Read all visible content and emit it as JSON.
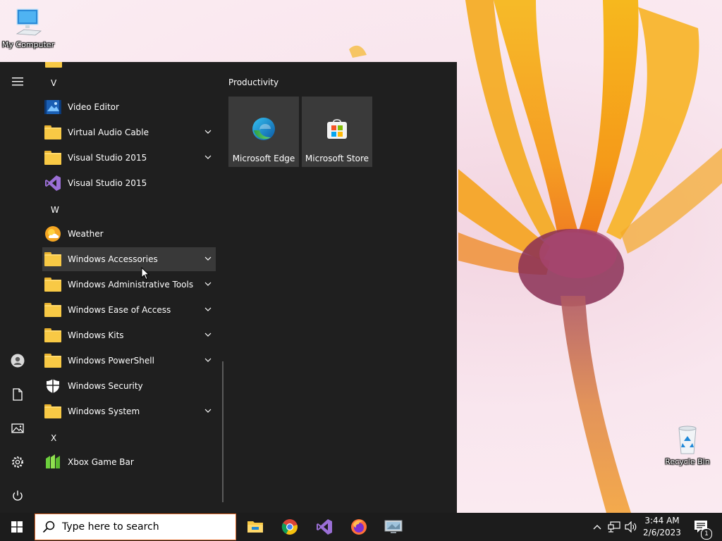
{
  "desktop": {
    "icons": [
      {
        "label": "My Computer"
      },
      {
        "label": "Recycle Bin"
      }
    ]
  },
  "start_menu": {
    "rail": [
      "menu-icon",
      "user-icon",
      "documents-icon",
      "pictures-icon",
      "settings-icon",
      "power-icon"
    ],
    "letters": {
      "v": "V",
      "w": "W",
      "x": "X"
    },
    "apps": [
      {
        "name": "Video Editor",
        "icon": "video-editor-icon",
        "expandable": false
      },
      {
        "name": "Virtual Audio Cable",
        "icon": "folder-icon",
        "expandable": true
      },
      {
        "name": "Visual Studio 2015",
        "icon": "folder-icon",
        "expandable": true
      },
      {
        "name": "Visual Studio 2015",
        "icon": "visual-studio-icon",
        "expandable": false
      },
      {
        "name": "Weather",
        "icon": "weather-icon",
        "expandable": false
      },
      {
        "name": "Windows Accessories",
        "icon": "folder-icon",
        "expandable": true,
        "hovered": true
      },
      {
        "name": "Windows Administrative Tools",
        "icon": "folder-icon",
        "expandable": true
      },
      {
        "name": "Windows Ease of Access",
        "icon": "folder-icon",
        "expandable": true
      },
      {
        "name": "Windows Kits",
        "icon": "folder-icon",
        "expandable": true
      },
      {
        "name": "Windows PowerShell",
        "icon": "folder-icon",
        "expandable": true
      },
      {
        "name": "Windows Security",
        "icon": "shield-icon",
        "expandable": false
      },
      {
        "name": "Windows System",
        "icon": "folder-icon",
        "expandable": true
      },
      {
        "name": "Xbox Game Bar",
        "icon": "xbox-game-bar-icon",
        "expandable": false
      }
    ],
    "tile_group": {
      "title": "Productivity",
      "tiles": [
        {
          "label": "Microsoft Edge",
          "icon": "edge-icon"
        },
        {
          "label": "Microsoft Store",
          "icon": "store-icon"
        }
      ]
    }
  },
  "taskbar": {
    "search_placeholder": "Type here to search",
    "pinned": [
      "file-explorer-icon",
      "chrome-icon",
      "visual-studio-icon",
      "firefox-icon",
      "remote-desktop-icon"
    ],
    "tray": [
      "chevron-up-icon",
      "network-icon",
      "volume-icon"
    ],
    "time": "3:44 AM",
    "date": "2/6/2023",
    "notification_count": "1"
  },
  "colors": {
    "menu_bg": "#1f1f1f",
    "tile_bg": "#3a3a3a",
    "hover_bg": "#393939",
    "taskbar_bg": "#1c1c1c",
    "search_border": "#e46d2d"
  }
}
